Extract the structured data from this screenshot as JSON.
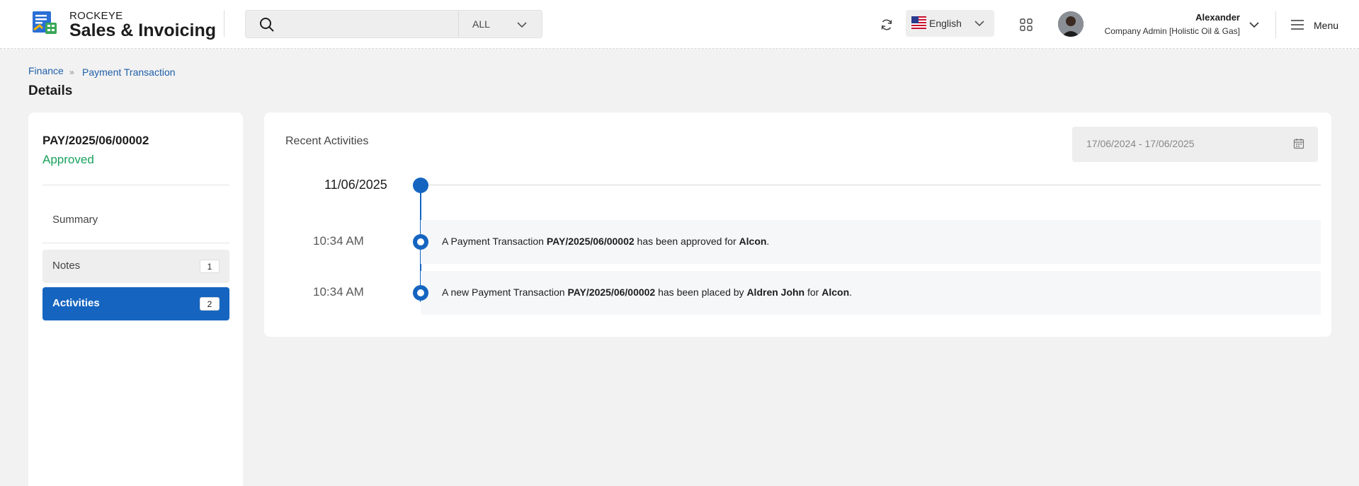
{
  "header": {
    "brand_top": "ROCKEYE",
    "brand_main": "Sales & Invoicing",
    "search": {
      "placeholder": "",
      "value": "",
      "scope": "ALL"
    },
    "language": "English",
    "user": {
      "name": "Alexander",
      "role": "Company Admin [Holistic Oil & Gas]"
    },
    "menu_label": "Menu"
  },
  "breadcrumb": {
    "items": [
      "Finance",
      "Payment Transaction"
    ]
  },
  "page_title": "Details",
  "sidebar": {
    "doc_number": "PAY/2025/06/00002",
    "status": "Approved",
    "summary_label": "Summary",
    "items": [
      {
        "label": "Notes",
        "count": "1"
      },
      {
        "label": "Activities",
        "count": "2"
      }
    ]
  },
  "main": {
    "section_title": "Recent Activities",
    "date_range": "17/06/2024 - 17/06/2025",
    "timeline": {
      "date": "11/06/2025",
      "entries": [
        {
          "time": "10:34 AM",
          "p1": "A Payment Transaction ",
          "b1": "PAY/2025/06/00002",
          "p2": " has been approved for ",
          "b2": "Alcon",
          "p3": "."
        },
        {
          "time": "10:34 AM",
          "p1": "A new Payment Transaction ",
          "b1": "PAY/2025/06/00002",
          "p2": " has been placed by ",
          "b2": "Aldren John",
          "p3": " for ",
          "b3": "Alcon",
          "p4": "."
        }
      ]
    }
  },
  "colors": {
    "primary": "#1565c0",
    "approved": "#19a05c",
    "link": "#1f5ea8"
  }
}
